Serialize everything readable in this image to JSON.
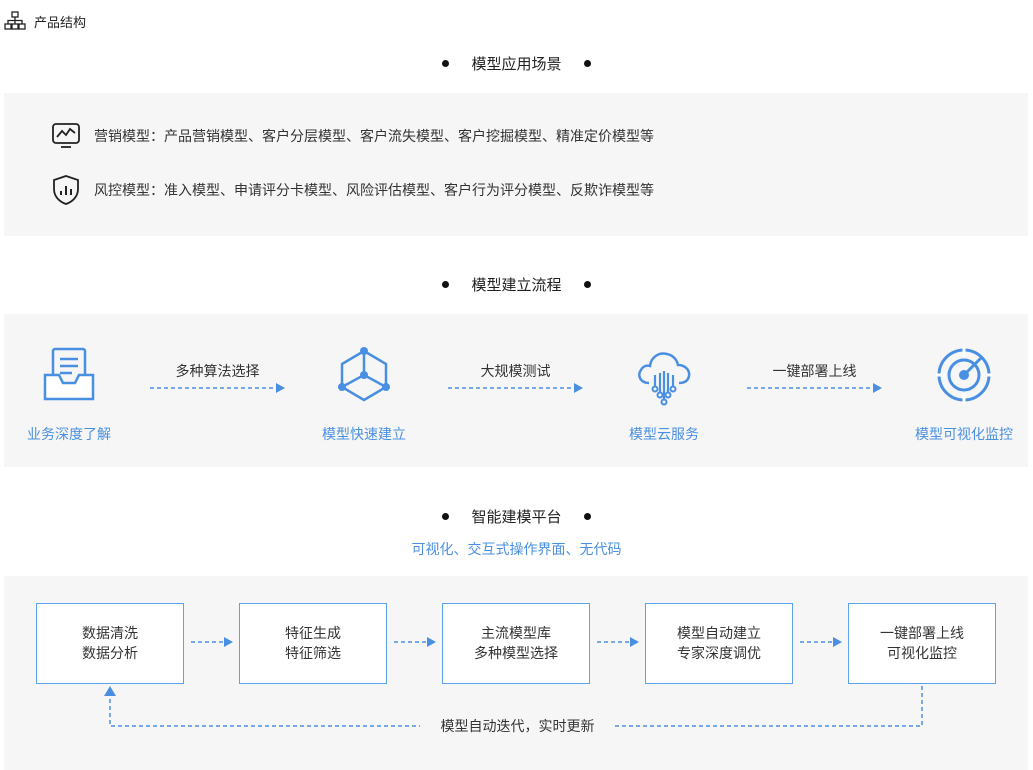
{
  "header": {
    "title": "产品结构",
    "icon": "org-chart-icon"
  },
  "scenes": {
    "title": "模型应用场景",
    "items": [
      {
        "icon": "chart-monitor-icon",
        "text": "营销模型：产品营销模型、客户分层模型、客户流失模型、客户挖掘模型、精准定价模型等"
      },
      {
        "icon": "shield-chart-icon",
        "text": "风控模型：准入模型、申请评分卡模型、风险评估模型、客户行为评分模型、反欺诈模型等"
      }
    ]
  },
  "process": {
    "title": "模型建立流程",
    "nodes": [
      {
        "label": "业务深度了解",
        "icon": "inbox-document-icon"
      },
      {
        "label": "模型快速建立",
        "icon": "cube-network-icon"
      },
      {
        "label": "模型云服务",
        "icon": "cloud-circuit-icon"
      },
      {
        "label": "模型可视化监控",
        "icon": "radar-icon"
      }
    ],
    "arrows": [
      "多种算法选择",
      "大规模测试",
      "一键部署上线"
    ]
  },
  "platform": {
    "title": "智能建模平台",
    "subtitle": "可视化、交互式操作界面、无代码",
    "boxes": [
      {
        "line1": "数据清洗",
        "line2": "数据分析"
      },
      {
        "line1": "特征生成",
        "line2": "特征筛选"
      },
      {
        "line1": "主流模型库",
        "line2": "多种模型选择"
      },
      {
        "line1": "模型自动建立",
        "line2": "专家深度调优"
      },
      {
        "line1": "一键部署上线",
        "line2": "可视化监控"
      }
    ],
    "loop_label": "模型自动迭代，实时更新"
  },
  "colors": {
    "accent": "#4a90e2",
    "panel": "#f6f6f6",
    "box_border": "#5ba3ec"
  }
}
